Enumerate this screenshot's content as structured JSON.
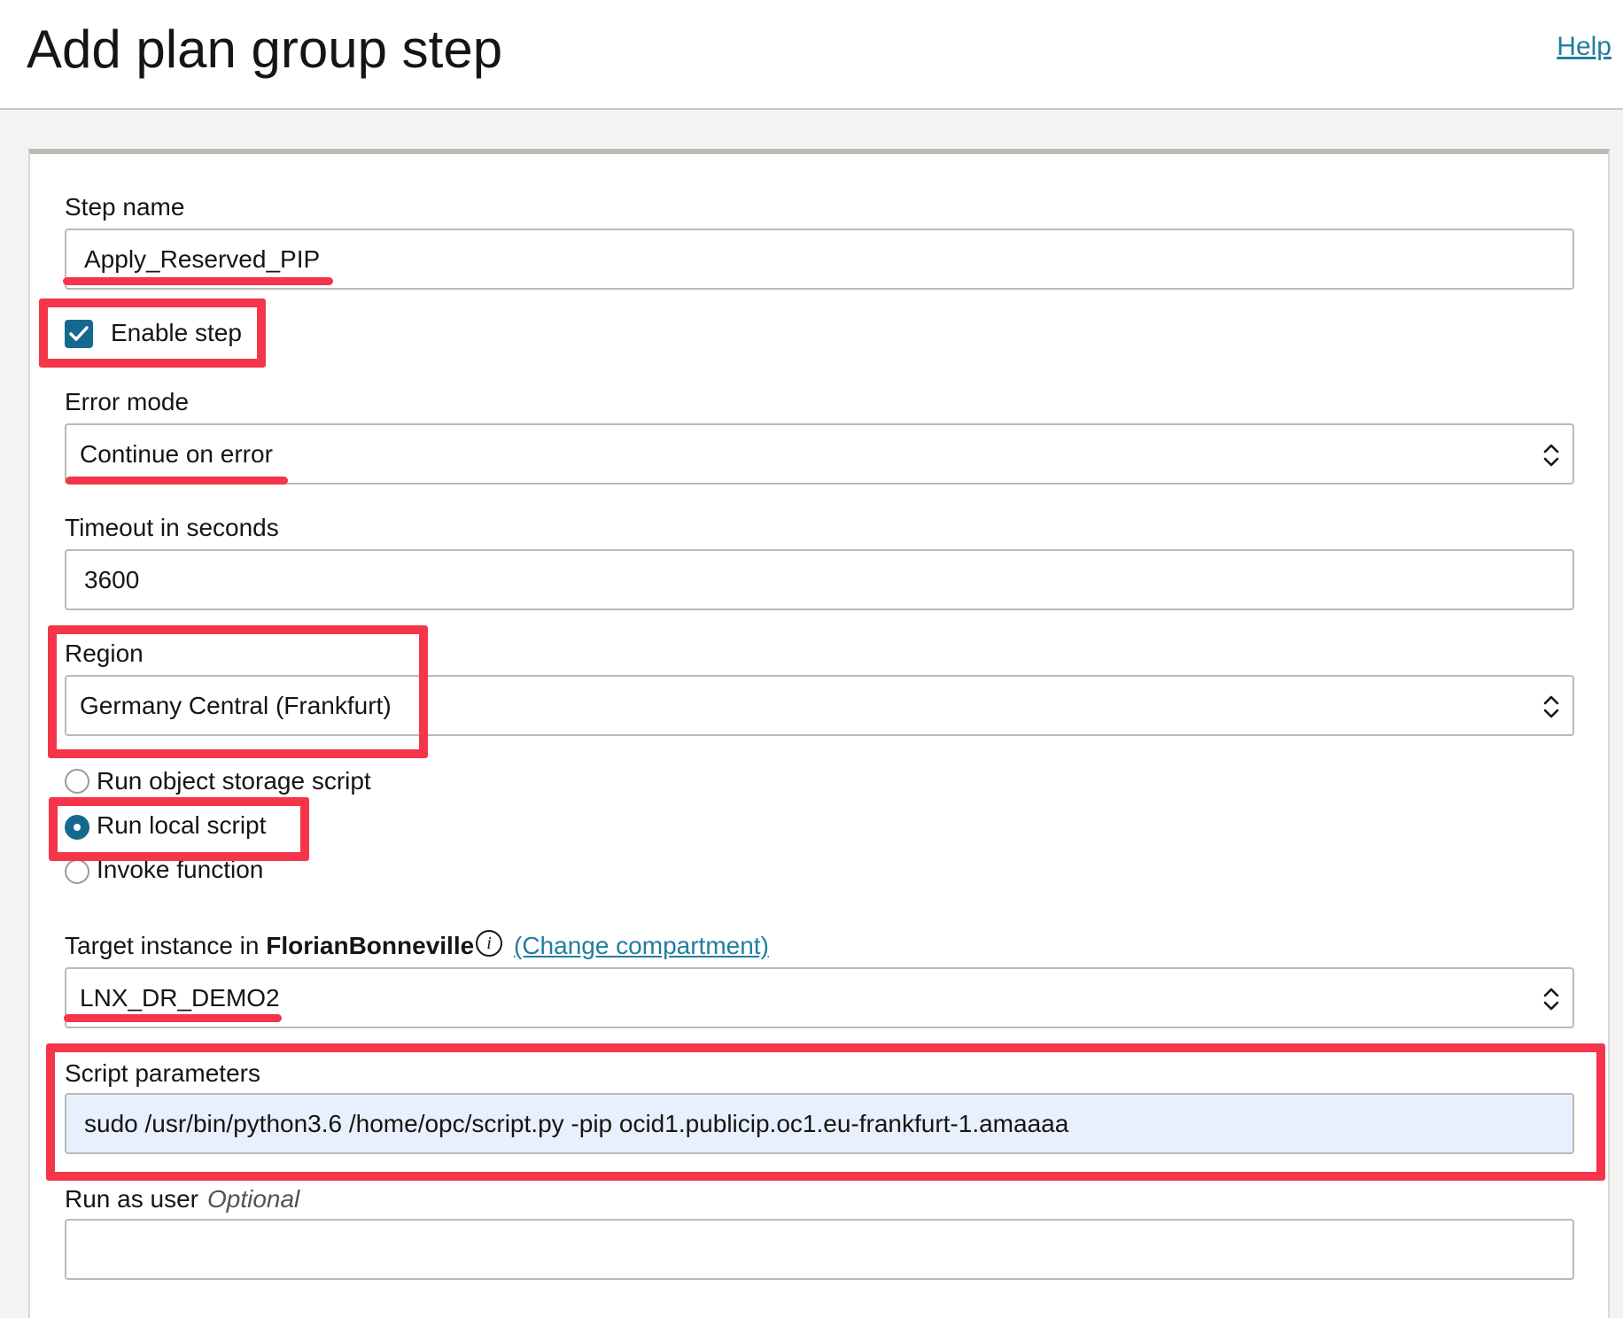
{
  "header": {
    "title": "Add plan group step",
    "help": "Help"
  },
  "form": {
    "step_name": {
      "label": "Step name",
      "value": "Apply_Reserved_PIP"
    },
    "enable_step": {
      "label": "Enable step",
      "checked": true
    },
    "error_mode": {
      "label": "Error mode",
      "value": "Continue on error"
    },
    "timeout": {
      "label": "Timeout in seconds",
      "value": "3600"
    },
    "region": {
      "label": "Region",
      "value": "Germany Central (Frankfurt)"
    },
    "script_type": {
      "options": [
        "Run object storage script",
        "Run local script",
        "Invoke function"
      ],
      "selected": "Run local script"
    },
    "target_instance": {
      "label_prefix": "Target instance in",
      "compartment": "FlorianBonneville",
      "change_link": "(Change compartment)",
      "value": "LNX_DR_DEMO2"
    },
    "script_parameters": {
      "label": "Script parameters",
      "value": "sudo /usr/bin/python3.6 /home/opc/script.py -pip ocid1.publicip.oc1.eu-frankfurt-1.amaaaa"
    },
    "run_as_user": {
      "label": "Run as user",
      "optional": "Optional",
      "value": ""
    }
  },
  "colors": {
    "accent": "#16688f",
    "link": "#227e9e",
    "annotation": "#f4354a"
  }
}
